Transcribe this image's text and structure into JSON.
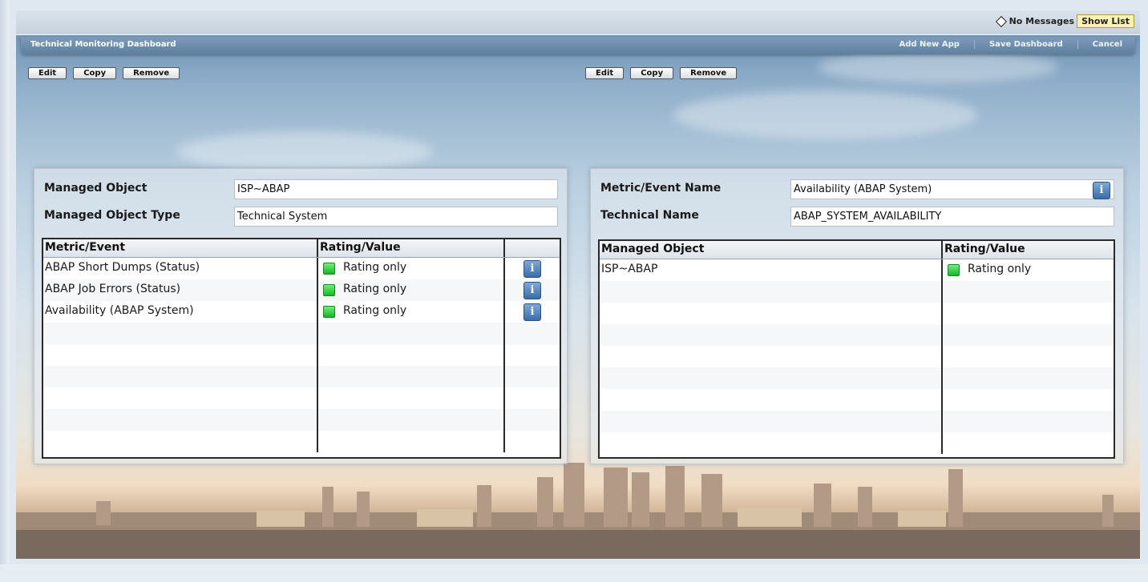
{
  "topbar": {
    "messages": "No Messages",
    "show_list": "Show List"
  },
  "dashboard": {
    "title": "Technical Monitoring Dashboard",
    "actions": [
      "Add New App",
      "Save Dashboard",
      "Cancel"
    ]
  },
  "toolbar_left": [
    "Edit",
    "Copy",
    "Remove"
  ],
  "toolbar_right": [
    "Edit",
    "Copy",
    "Remove"
  ],
  "left_panel": {
    "managed_object_label": "Managed Object",
    "managed_object_value": "ISP~ABAP",
    "managed_object_type_label": "Managed Object Type",
    "managed_object_type_value": "Technical System",
    "columns": [
      "Metric/Event",
      "Rating/Value",
      ""
    ],
    "rows": [
      {
        "metric": "ABAP Short Dumps (Status)",
        "rating": "Rating only",
        "status": "green"
      },
      {
        "metric": "ABAP Job Errors (Status)",
        "rating": "Rating only",
        "status": "green"
      },
      {
        "metric": "Availability (ABAP System)",
        "rating": "Rating only",
        "status": "green"
      }
    ]
  },
  "right_panel": {
    "metric_label": "Metric/Event Name",
    "metric_value": "Availability (ABAP System)",
    "technical_label": "Technical Name",
    "technical_value": "ABAP_SYSTEM_AVAILABILITY",
    "columns": [
      "Managed Object",
      "Rating/Value"
    ],
    "rows": [
      {
        "object": "ISP~ABAP",
        "rating": "Rating only",
        "status": "green"
      }
    ]
  },
  "icons": {
    "info": "i",
    "status": "green-square-icon"
  },
  "colors": {
    "title_bar": "#5f7f9f",
    "status_green": "#17b52a",
    "show_list_bg": "#fdf1b3"
  }
}
